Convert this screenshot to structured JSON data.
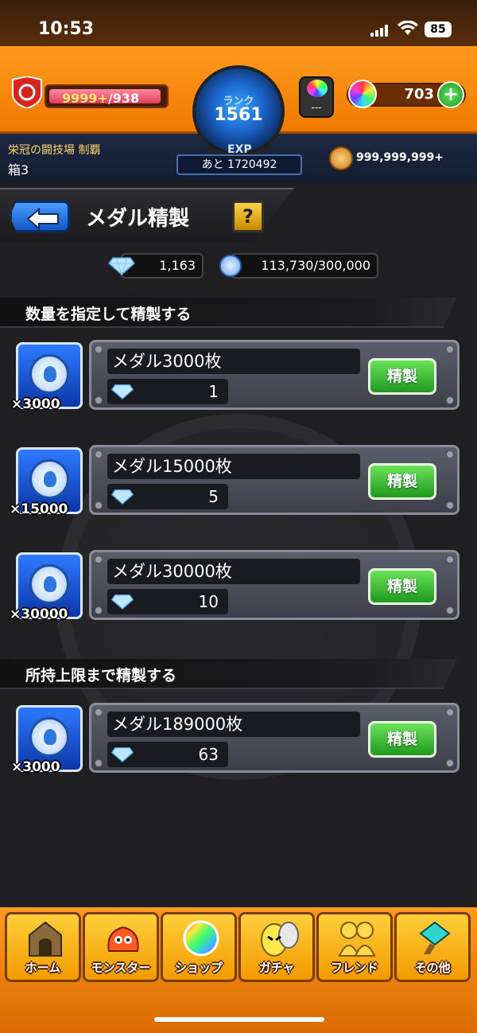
{
  "status": {
    "time": "10:53",
    "battery": "85"
  },
  "header": {
    "hp": "9999+",
    "hp_max": "/938",
    "rank_label": "ランク",
    "rank": "1561",
    "exp_label": "EXP",
    "exp_remaining": "あと 1720492",
    "gacha_label": "---",
    "orbs": "703",
    "event_title": "栄冠の闘技場 制覇",
    "event_box": "箱3",
    "coins": "999,999,999+"
  },
  "page": {
    "title": "メダル精製",
    "help": "?"
  },
  "currency": {
    "gems": "1,163",
    "medals": "113,730/300,000"
  },
  "sections": {
    "specify": "数量を指定して精製する",
    "max": "所持上限まで精製する"
  },
  "rows": [
    {
      "qty": "×3000",
      "name": "メダル3000枚",
      "cost": "1",
      "button": "精製"
    },
    {
      "qty": "×15000",
      "name": "メダル15000枚",
      "cost": "5",
      "button": "精製"
    },
    {
      "qty": "×30000",
      "name": "メダル30000枚",
      "cost": "10",
      "button": "精製"
    },
    {
      "qty": "×3000",
      "name": "メダル189000枚",
      "cost": "63",
      "button": "精製"
    }
  ],
  "nav": [
    {
      "label": "ホーム",
      "icon": "home-icon"
    },
    {
      "label": "モンスター",
      "icon": "monster-icon"
    },
    {
      "label": "ショップ",
      "icon": "shop-orb-icon"
    },
    {
      "label": "ガチャ",
      "icon": "gacha-egg-icon"
    },
    {
      "label": "フレンド",
      "icon": "friends-icon"
    },
    {
      "label": "その他",
      "icon": "other-icon"
    }
  ]
}
